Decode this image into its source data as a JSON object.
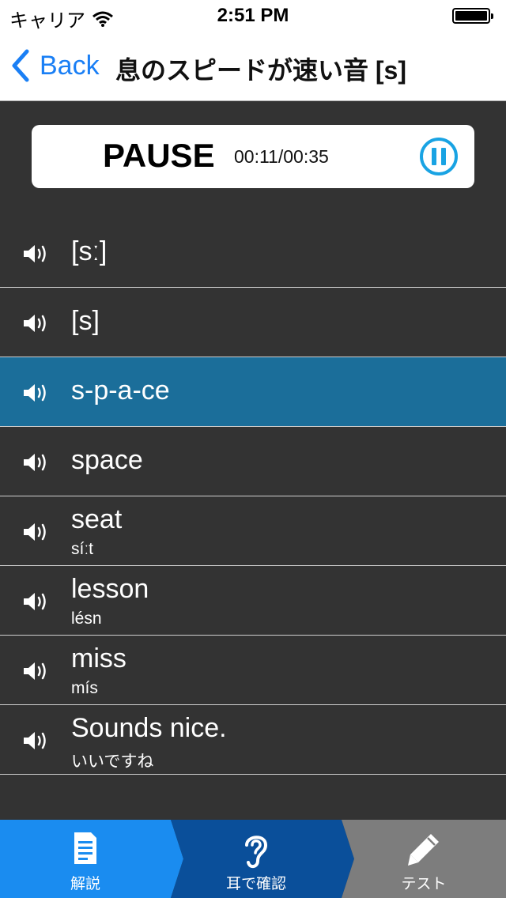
{
  "status_bar": {
    "carrier": "キャリア",
    "time": "2:51 PM"
  },
  "nav": {
    "back_label": "Back",
    "title": "息のスピードが速い音 [s]"
  },
  "player": {
    "state": "PAUSE",
    "timecode": "00:11/00:35"
  },
  "list": {
    "items": [
      {
        "word": "[sː]",
        "pron": ""
      },
      {
        "word": "[s]",
        "pron": ""
      },
      {
        "word": "s-p-a-ce",
        "pron": ""
      },
      {
        "word": "space",
        "pron": ""
      },
      {
        "word": "seat",
        "pron": "síːt"
      },
      {
        "word": "lesson",
        "pron": "lésn"
      },
      {
        "word": "miss",
        "pron": "mís"
      },
      {
        "word": "Sounds nice.",
        "pron": "いいですね"
      }
    ]
  },
  "tabs": [
    {
      "label": "解説",
      "icon": "document-icon"
    },
    {
      "label": "耳で確認",
      "icon": "ear-icon"
    },
    {
      "label": "テスト",
      "icon": "pencil-icon"
    }
  ],
  "colors": {
    "accent": "#1a7ff5",
    "active_row": "#1b6e9a",
    "tab_1": "#1a8cf0",
    "tab_2": "#0a4f9a",
    "tab_3": "#7d7d7d",
    "background": "#333333"
  }
}
